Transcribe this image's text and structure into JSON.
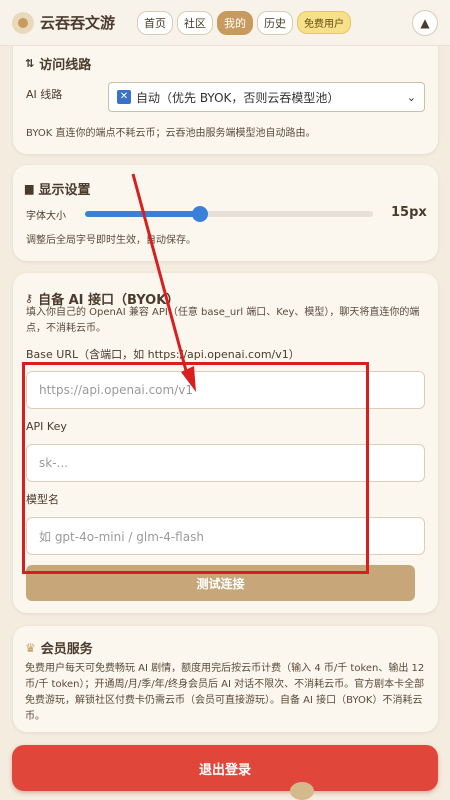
{
  "app": {
    "name": "云吞吞文游"
  },
  "nav": {
    "items": [
      {
        "label": "首页",
        "active": false
      },
      {
        "label": "社区",
        "active": false
      },
      {
        "label": "我的",
        "active": true
      },
      {
        "label": "历史",
        "active": false
      }
    ],
    "badge": "免费用户",
    "up_icon": "▲"
  },
  "route": {
    "title": "访问线路",
    "ai_label": "AI 线路",
    "selected": "自动（优先 BYOK，否则云吞模型池）",
    "note": "BYOK 直连你的端点不耗云币；云吞池由服务端模型池自动路由。"
  },
  "display": {
    "title": "显示设置",
    "font_label": "字体大小",
    "font_value": "15px",
    "font_level": 0.4,
    "note": "调整后全局字号即时生效，自动保存。"
  },
  "byok": {
    "title": "自备 AI 接口（BYOK）",
    "desc": "填入你自己的 OpenAI 兼容 API（任意 base_url 端口、Key、模型），聊天将直连你的端点，不消耗云币。",
    "base_url_label": "Base URL（含端口，如 https://api.openai.com/v1）",
    "base_url_placeholder": "https://api.openai.com/v1",
    "key_label": "API Key",
    "key_placeholder": "sk-...",
    "model_label": "模型名",
    "model_placeholder": "如 gpt-4o-mini / glm-4-flash",
    "test_button": "测试连接"
  },
  "membership": {
    "title": "会员服务",
    "text": "免费用户每天可免费畅玩 AI 剧情，额度用完后按云币计费（输入 4 币/千 token、输出 12 币/千 token）；开通周/月/季/年/终身会员后 AI 对话不限次、不消耗云币。官方剧本卡全部免费游玩，解锁社区付费卡仍需云币（会员可直接游玩）。自备 AI 接口（BYOK）不消耗云币。"
  },
  "logout": "退出登录",
  "colors": {
    "accent": "#c79a5d",
    "danger": "#e0473a",
    "slider": "#3b80d8",
    "annotation": "#d81e1e"
  }
}
